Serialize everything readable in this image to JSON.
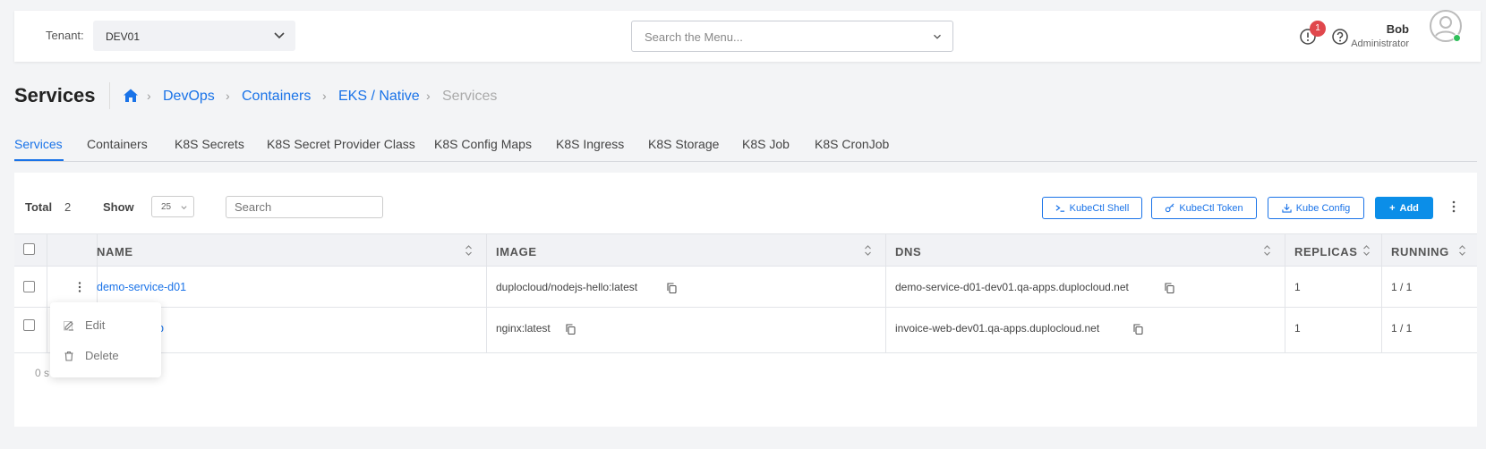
{
  "header": {
    "tenant_label": "Tenant:",
    "tenant_value": "DEV01",
    "menu_search_placeholder": "Search the Menu...",
    "alert_count": "1",
    "user_name": "Bob",
    "user_role": "Administrator"
  },
  "page": {
    "title": "Services",
    "breadcrumb": [
      "DevOps",
      "Containers",
      "EKS / Native",
      "Services"
    ]
  },
  "tabs": [
    "Services",
    "Containers",
    "K8S Secrets",
    "K8S Secret Provider Class",
    "K8S Config Maps",
    "K8S Ingress",
    "K8S Storage",
    "K8S Job",
    "K8S CronJob"
  ],
  "toolbar": {
    "total_label": "Total",
    "total_count": "2",
    "show_label": "Show",
    "show_value": "25",
    "search_placeholder": "Search",
    "kubectl_shell": "KubeCtl Shell",
    "kubectl_token": "KubeCtl Token",
    "kube_config": "Kube Config",
    "add": "Add"
  },
  "table": {
    "columns": [
      "NAME",
      "IMAGE",
      "DNS",
      "REPLICAS",
      "RUNNING"
    ],
    "rows": [
      {
        "name": "demo-service-d01",
        "image": "duplocloud/nodejs-hello:latest",
        "dns": "demo-service-d01-dev01.qa-apps.duplocloud.net",
        "replicas": "1",
        "running": "1 / 1"
      },
      {
        "name_partial": "b",
        "image": "nginx:latest",
        "dns": "invoice-web-dev01.qa-apps.duplocloud.net",
        "replicas": "1",
        "running": "1 / 1"
      }
    ],
    "footer_partial": "0 s"
  },
  "context_menu": {
    "edit": "Edit",
    "delete": "Delete"
  },
  "colors": {
    "accent": "#1a73e8",
    "add_button": "#0b8ee8",
    "alert": "#e0474c",
    "online": "#2fbf5a"
  }
}
